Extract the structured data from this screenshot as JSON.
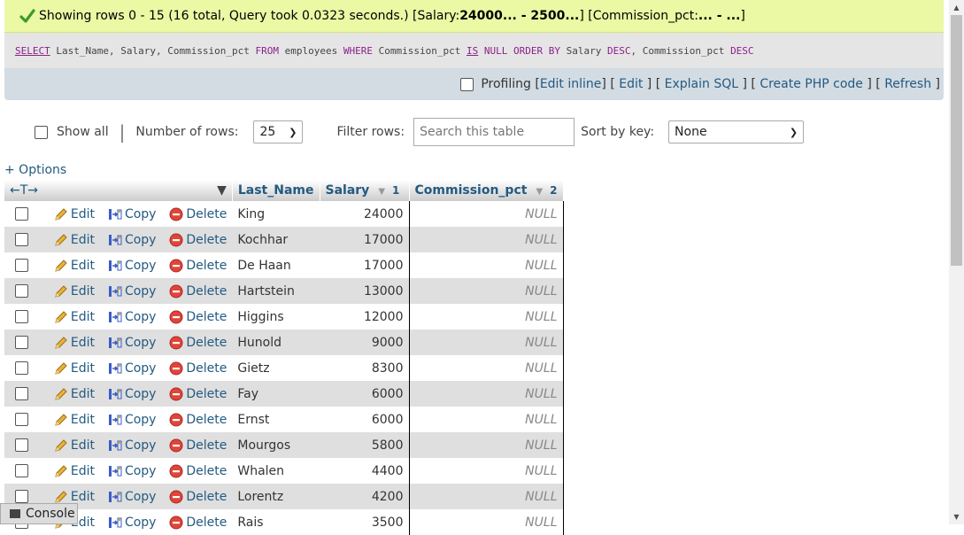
{
  "status": {
    "prefix": "Showing rows 0 - 15 (16 total, Query took 0.0323 seconds.) [Salary: ",
    "salary_range": "24000... - 2500...",
    "middle": "] [Commission_pct: ",
    "commission_range": "... - ...",
    "suffix": "]"
  },
  "sql": {
    "select": "SELECT",
    "part1": " Last_Name, Salary, Commission_pct ",
    "from": "FROM",
    "part2": " employees ",
    "where": "WHERE",
    "part3": " Commission_pct ",
    "is": "IS",
    "part4": " ",
    "null": "NULL",
    "part5": " ",
    "orderby": "ORDER BY",
    "part6": " Salary ",
    "desc1": "DESC",
    "part7": ", Commission_pct ",
    "desc2": "DESC"
  },
  "tools": {
    "profiling": "Profiling",
    "edit_inline": "Edit inline",
    "edit": "Edit",
    "explain": "Explain SQL",
    "php": "Create PHP code",
    "refresh": "Refresh"
  },
  "nav": {
    "show_all": "Show all",
    "num_rows_label": "Number of rows:",
    "num_rows_value": "25",
    "filter_label": "Filter rows:",
    "filter_placeholder": "Search this table",
    "sort_label": "Sort by key:",
    "sort_value": "None"
  },
  "options_link": "+ Options",
  "table": {
    "columns": [
      "Last_Name",
      "Salary",
      "Commission_pct"
    ],
    "salary_sort_order": "1",
    "commission_sort_order": "2",
    "actions": {
      "edit": "Edit",
      "copy": "Copy",
      "delete": "Delete"
    },
    "rows": [
      {
        "name": "King",
        "salary": "24000",
        "comm": "NULL"
      },
      {
        "name": "Kochhar",
        "salary": "17000",
        "comm": "NULL"
      },
      {
        "name": "De Haan",
        "salary": "17000",
        "comm": "NULL"
      },
      {
        "name": "Hartstein",
        "salary": "13000",
        "comm": "NULL"
      },
      {
        "name": "Higgins",
        "salary": "12000",
        "comm": "NULL"
      },
      {
        "name": "Hunold",
        "salary": "9000",
        "comm": "NULL"
      },
      {
        "name": "Gietz",
        "salary": "8300",
        "comm": "NULL"
      },
      {
        "name": "Fay",
        "salary": "6000",
        "comm": "NULL"
      },
      {
        "name": "Ernst",
        "salary": "6000",
        "comm": "NULL"
      },
      {
        "name": "Mourgos",
        "salary": "5800",
        "comm": "NULL"
      },
      {
        "name": "Whalen",
        "salary": "4400",
        "comm": "NULL"
      },
      {
        "name": "Lorentz",
        "salary": "4200",
        "comm": "NULL"
      },
      {
        "name": "Rais",
        "salary": "3500",
        "comm": "NULL"
      }
    ]
  },
  "console": {
    "label": "Console"
  },
  "colors": {
    "success_bg": "#ebf8a4",
    "link": "#235a81",
    "keyword": "#8b1f8b"
  }
}
